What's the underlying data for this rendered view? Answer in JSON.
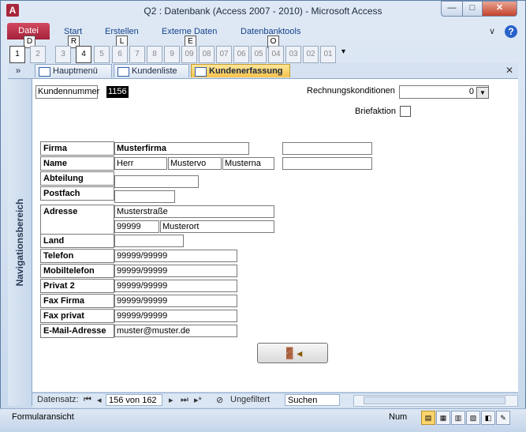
{
  "window": {
    "title": "Q2 : Datenbank (Access 2007 - 2010)  -  Microsoft Access",
    "app_icon_letter": "A",
    "min_glyph": "—",
    "max_glyph": "□",
    "close_glyph": "✕"
  },
  "ribbon": {
    "tabs": [
      "Datei",
      "Start",
      "Erstellen",
      "Externe Daten",
      "Datenbanktools"
    ],
    "keytips": [
      "D",
      "R",
      "L",
      "E",
      "O"
    ],
    "collapse_glyph": "∨",
    "help_glyph": "?"
  },
  "qat": {
    "keytips": [
      "1",
      "2",
      "3",
      "4",
      "5",
      "6",
      "7",
      "8",
      "9",
      "09",
      "08",
      "07",
      "06",
      "05",
      "04",
      "03",
      "02",
      "01"
    ],
    "dropdown_glyph": "▾"
  },
  "doc_tabs": {
    "chevron": "»",
    "tabs": [
      "Hauptmenü",
      "Kundenliste",
      "Kundenerfassung"
    ],
    "active": 2,
    "close_glyph": "✕"
  },
  "nav_pane": {
    "label": "Navigationsbereich"
  },
  "form": {
    "kundennummer_label": "Kundennummer",
    "kundennummer_value": "1156",
    "rechnungskonditionen_label": "Rechnungskonditionen",
    "rechnungskonditionen_value": "0",
    "briefaktion_label": "Briefaktion",
    "briefaktion_checked": false,
    "labels": {
      "firma": "Firma",
      "name": "Name",
      "abteilung": "Abteilung",
      "postfach": "Postfach",
      "adresse": "Adresse",
      "land": "Land",
      "telefon": "Telefon",
      "mobiltelefon": "Mobiltelefon",
      "privat2": "Privat 2",
      "fax_firma": "Fax Firma",
      "fax_privat": "Fax privat",
      "email": "E-Mail-Adresse"
    },
    "values": {
      "firma": "Musterfirma",
      "anrede": "Herr",
      "vorname": "Mustervo",
      "nachname": "Musterna",
      "abteilung": "",
      "postfach": "",
      "strasse": "Musterstraße",
      "plz": "99999",
      "ort": "Musterort",
      "land": "",
      "telefon": "99999/99999",
      "mobiltelefon": "99999/99999",
      "privat2": "99999/99999",
      "fax_firma": "99999/99999",
      "fax_privat": "99999/99999",
      "email": "muster@muster.de"
    }
  },
  "record_nav": {
    "label": "Datensatz:",
    "first": "⏮",
    "prev": "◂",
    "current": "156 von 162",
    "next": "▸",
    "last": "⏭",
    "new": "▸*",
    "filter": "Ungefiltert",
    "search": "Suchen"
  },
  "status": {
    "text": "Formularansicht",
    "num": "Num"
  }
}
